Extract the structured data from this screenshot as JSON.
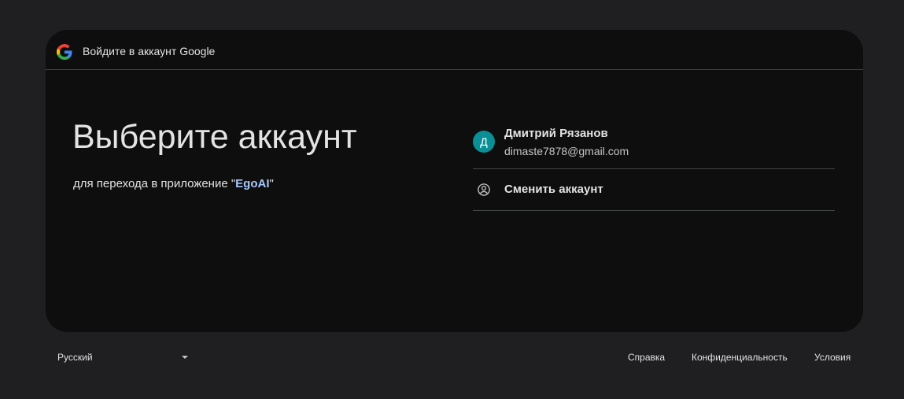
{
  "header": {
    "logo_icon": "google-g-icon",
    "title": "Войдите в аккаунт Google"
  },
  "main": {
    "title": "Выберите аккаунт",
    "subtitle_prefix": "для перехода в приложение \"",
    "app_name": "EgoAI",
    "subtitle_suffix": "\"",
    "app_name_color": "#a8c7fa"
  },
  "accounts": [
    {
      "avatar_letter": "Д",
      "avatar_color": "#0a8f96",
      "name": "Дмитрий Рязанов",
      "email": "dimaste7878@gmail.com"
    }
  ],
  "switch_account": {
    "icon": "account-circle-icon",
    "label": "Сменить аккаунт"
  },
  "footer": {
    "language": "Русский",
    "links": {
      "help": "Справка",
      "privacy": "Конфиденциальность",
      "terms": "Условия"
    }
  },
  "colors": {
    "page_background": "#1f1f21",
    "card_background": "#0e0e0e",
    "divider": "#444746",
    "text": "#e3e3e3"
  }
}
